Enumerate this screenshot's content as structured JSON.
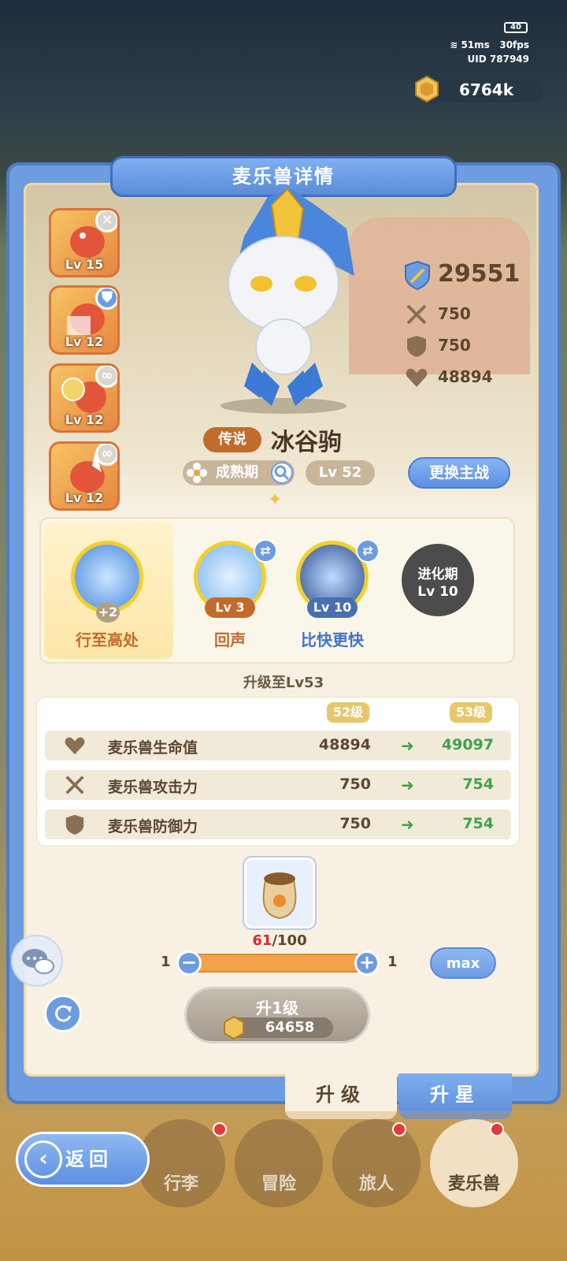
{
  "hud": {
    "battery": "40",
    "latency": "51ms",
    "fps": "30fps",
    "uid": "UID 787949",
    "coins": "6764k"
  },
  "panel": {
    "title": "麦乐兽详情"
  },
  "slots": [
    {
      "level": "Lv 15",
      "badge": "close-icon"
    },
    {
      "level": "Lv 12",
      "badge": "shield-icon"
    },
    {
      "level": "Lv 12",
      "badge": "link-icon"
    },
    {
      "level": "Lv 12",
      "badge": "link-icon"
    }
  ],
  "stats": {
    "power": "29551",
    "attack": "750",
    "defense": "750",
    "hp": "48894"
  },
  "pet": {
    "rarity": "传说",
    "name": "冰谷驹",
    "stage": "成熟期",
    "level": "Lv 52",
    "swap_label": "更换主战"
  },
  "skills": [
    {
      "name": "行至高处",
      "badge": "+2"
    },
    {
      "name": "回声",
      "level": "Lv 3"
    },
    {
      "name": "比快更快",
      "level": "Lv 10"
    },
    {
      "locked_line1": "进化期",
      "locked_line2": "Lv 10"
    }
  ],
  "upgrade": {
    "title": "升级至Lv53",
    "from_label": "52级",
    "to_label": "53级",
    "rows": [
      {
        "name": "麦乐兽生命值",
        "current": "48894",
        "next": "49097",
        "icon": "heart-icon"
      },
      {
        "name": "麦乐兽攻击力",
        "current": "750",
        "next": "754",
        "icon": "swords-icon"
      },
      {
        "name": "麦乐兽防御力",
        "current": "750",
        "next": "754",
        "icon": "shield-icon"
      }
    ],
    "item_have": "61",
    "item_need": "/100",
    "slider_min": "1",
    "slider_max": "1",
    "slider_fraction": 1.0,
    "max_label": "max",
    "button_label": "升1级",
    "button_cost": "64658"
  },
  "tabs": {
    "upgrade": "升级",
    "star": "升星"
  },
  "nav": {
    "back": "返回",
    "items": [
      "行李",
      "冒险",
      "旅人",
      "麦乐兽"
    ]
  },
  "colors": {
    "accent_blue": "#6d9ce0",
    "rarity_orange": "#c36b2a",
    "increase_green": "#3aa54a",
    "insufficient_red": "#d22f2f"
  }
}
